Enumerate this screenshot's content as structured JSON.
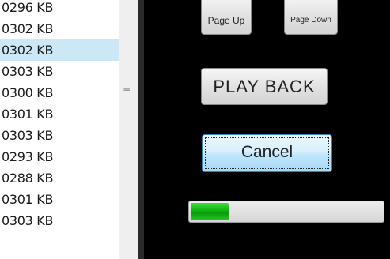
{
  "file_list": {
    "rows": [
      "0296 KB",
      "0302 KB",
      "0302 KB",
      "0303 KB",
      "0300 KB",
      "0301 KB",
      "0303 KB",
      "0293 KB",
      "0288 KB",
      "0301 KB",
      "0303 KB"
    ],
    "selected_index": 2
  },
  "splitter": {
    "grip": "≡"
  },
  "controls": {
    "page_up_label": "Page Up",
    "page_down_label": "Page Down",
    "playback_label": "PLAY BACK",
    "cancel_label": "Cancel"
  },
  "progress": {
    "fraction": 0.2
  },
  "colors": {
    "selection": "#cce8f7",
    "progress_fill": "#1cc21c",
    "panel_bg": "#000000"
  }
}
